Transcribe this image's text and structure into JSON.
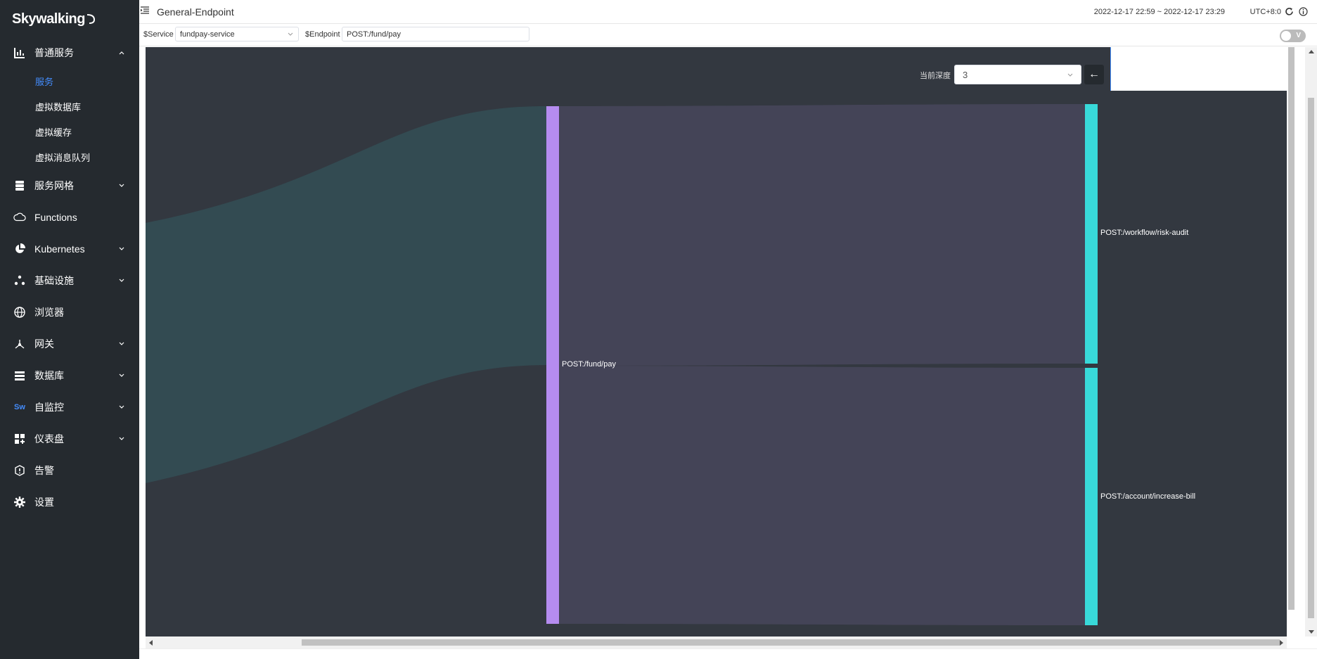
{
  "app": {
    "logo_text": "Skywalking"
  },
  "sidebar": {
    "items": [
      {
        "label": "普通服务",
        "icon": "chart-icon",
        "expanded": true,
        "children": [
          {
            "label": "服务",
            "active": true
          },
          {
            "label": "虚拟数据库"
          },
          {
            "label": "虚拟缓存"
          },
          {
            "label": "虚拟消息队列"
          }
        ]
      },
      {
        "label": "服务网格",
        "icon": "layers-icon"
      },
      {
        "label": "Functions",
        "icon": "cloud-icon"
      },
      {
        "label": "Kubernetes",
        "icon": "pie-icon"
      },
      {
        "label": "基础设施",
        "icon": "dots-icon"
      },
      {
        "label": "浏览器",
        "icon": "globe-icon"
      },
      {
        "label": "网关",
        "icon": "gateway-icon"
      },
      {
        "label": "数据库",
        "icon": "database-icon"
      },
      {
        "label": "自监控",
        "icon": "sw-icon",
        "icon_text": "Sw"
      },
      {
        "label": "仪表盘",
        "icon": "dashboard-icon"
      },
      {
        "label": "告警",
        "icon": "alarm-icon"
      },
      {
        "label": "设置",
        "icon": "gear-icon"
      }
    ]
  },
  "header": {
    "title": "General-Endpoint",
    "time_range": "2022-12-17 22:59 ~ 2022-12-17 23:29",
    "timezone": "UTC+8:0"
  },
  "selectors": {
    "service_label": "$Service",
    "service_value": "fundpay-service",
    "endpoint_label": "$Endpoint",
    "endpoint_value": "POST:/fund/pay",
    "toggle_label": "V"
  },
  "depth": {
    "label": "当前深度",
    "value": "3",
    "back_symbol": "←"
  },
  "sankey": {
    "nodes": [
      {
        "name": "POST:/fund/pay",
        "color": "#b58cf0"
      },
      {
        "name": "POST:/workflow/risk-audit",
        "color": "#38d9d9"
      },
      {
        "name": "POST:/account/increase-bill",
        "color": "#38d9d9"
      }
    ],
    "colors": {
      "incoming_flow": "#334b52",
      "outgoing_flow": "#444457",
      "background": "#333840"
    }
  }
}
